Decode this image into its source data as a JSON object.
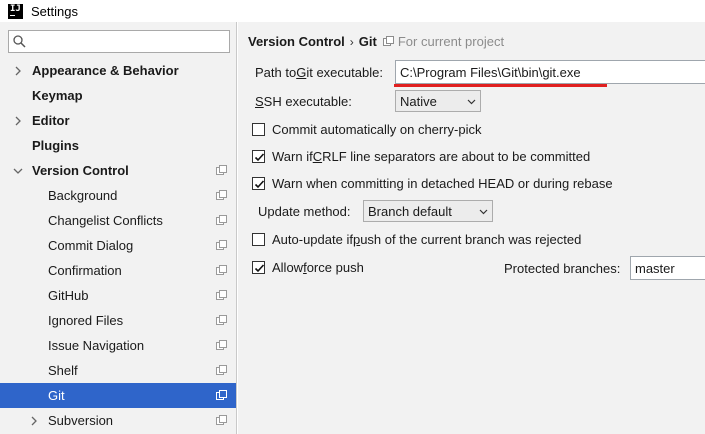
{
  "window": {
    "title": "Settings"
  },
  "search": {
    "placeholder": ""
  },
  "tree": {
    "items": [
      {
        "label": "Appearance & Behavior",
        "bold": true,
        "arrow": "right",
        "level": 0
      },
      {
        "label": "Keymap",
        "bold": true,
        "arrow": null,
        "level": 0
      },
      {
        "label": "Editor",
        "bold": true,
        "arrow": "right",
        "level": 0
      },
      {
        "label": "Plugins",
        "bold": true,
        "arrow": null,
        "level": 0
      },
      {
        "label": "Version Control",
        "bold": true,
        "arrow": "down",
        "level": 0,
        "project_icon": true
      },
      {
        "label": "Background",
        "level": 1,
        "project_icon": true
      },
      {
        "label": "Changelist Conflicts",
        "level": 1,
        "project_icon": true
      },
      {
        "label": "Commit Dialog",
        "level": 1,
        "project_icon": true
      },
      {
        "label": "Confirmation",
        "level": 1,
        "project_icon": true
      },
      {
        "label": "GitHub",
        "level": 1,
        "project_icon": true
      },
      {
        "label": "Ignored Files",
        "level": 1,
        "project_icon": true
      },
      {
        "label": "Issue Navigation",
        "level": 1,
        "project_icon": true
      },
      {
        "label": "Shelf",
        "level": 1,
        "project_icon": true
      },
      {
        "label": "Git",
        "level": 1,
        "project_icon": true,
        "selected": true
      },
      {
        "label": "Subversion",
        "level": 1,
        "arrow": "right",
        "project_icon": true
      }
    ]
  },
  "breadcrumb": {
    "parent": "Version Control",
    "separator": "›",
    "current": "Git",
    "scope": "For current project"
  },
  "git": {
    "path_label_pre": "Path to ",
    "path_label_mnemonic": "G",
    "path_label_post": "it executable:",
    "path_value": "C:\\Program Files\\Git\\bin\\git.exe",
    "ssh_label_mnemonic": "S",
    "ssh_label_post": "SH executable:",
    "ssh_value": "Native",
    "commit_cherry_pick": {
      "label": "Commit automatically on cherry-pick",
      "checked": false
    },
    "warn_crlf": {
      "label_pre": "Warn if ",
      "label_mnemonic": "C",
      "label_post": "RLF line separators are about to be committed",
      "checked": true
    },
    "warn_detached": {
      "label": "Warn when committing in detached HEAD or during rebase",
      "checked": true
    },
    "update_method_label": "Update method:",
    "update_method_value": "Branch default",
    "auto_update": {
      "label_pre": "Auto-update if ",
      "label_mnemonic": "p",
      "label_post": "ush of the current branch was rejected",
      "checked": false
    },
    "allow_force_push": {
      "label_pre": "Allow ",
      "label_mnemonic": "f",
      "label_post": "orce push",
      "checked": true
    },
    "protected_branches_label": "Protected branches:",
    "protected_branches_value": "master"
  },
  "colors": {
    "selection": "#2f65ca",
    "pane_bg": "#f2f2f2",
    "highlight_underline": "#e02020"
  }
}
